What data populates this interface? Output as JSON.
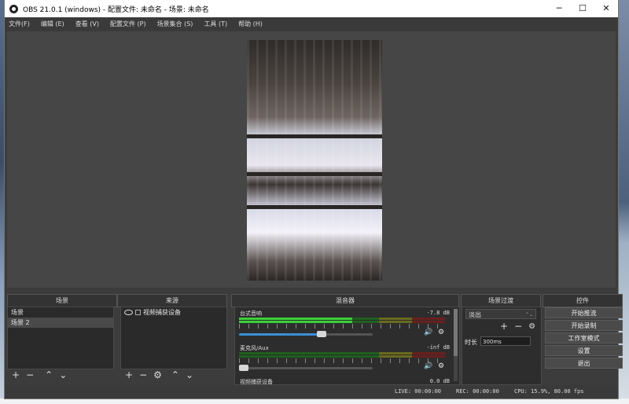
{
  "window": {
    "title": "OBS 21.0.1 (windows) - 配置文件: 未命名 - 场景: 未命名",
    "buttons": {
      "minimize": "─",
      "maximize": "☐",
      "close": "✕"
    }
  },
  "menu": [
    "文件(F)",
    "编辑 (E)",
    "查看 (V)",
    "配置文件 (P)",
    "场景集合 (S)",
    "工具 (T)",
    "帮助 (H)"
  ],
  "docks": {
    "scenes": {
      "title": "场景",
      "items": [
        "场景",
        "场景 2"
      ],
      "selected_index": 1
    },
    "sources": {
      "title": "来源",
      "items": [
        "视频捕获设备"
      ]
    },
    "mixer": {
      "title": "混音器",
      "channels": [
        {
          "name": "台式音响",
          "db": "-7.8 dB",
          "level": 0.55,
          "volume": 0.62
        },
        {
          "name": "麦克风/Aux",
          "db": "-inf dB",
          "level": 0.0,
          "volume": 0.0
        },
        {
          "name": "视频捕获设备",
          "db": "0.0 dB"
        }
      ]
    },
    "transitions": {
      "title": "场景过渡",
      "selected": "淡出",
      "duration_label": "时长",
      "duration_value": "300ms"
    },
    "controls": {
      "title": "控件",
      "buttons": [
        "开始推流",
        "开始录制",
        "工作室模式",
        "设置",
        "退出"
      ]
    }
  },
  "status": {
    "live": "LIVE: 00:00:00",
    "rec": "REC: 00:00:00",
    "cpu": "CPU: 15.9%, 80.00 fps"
  }
}
